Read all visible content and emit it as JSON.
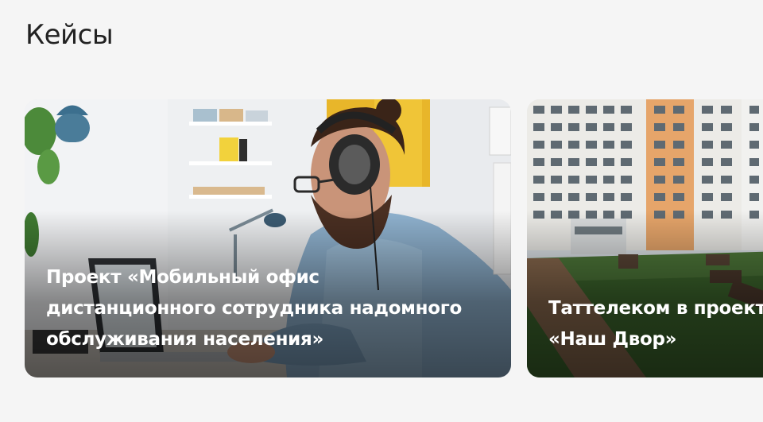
{
  "section": {
    "title": "Кейсы"
  },
  "cards": [
    {
      "caption": "Проект «Мобильный офис\nдистанционного сотрудника надомного\nобслуживания населения»",
      "image_subject": "man-with-headphones-at-laptop"
    },
    {
      "caption": "Таттелеком в проекте\n«Наш Двор»",
      "image_subject": "residential-courtyard"
    }
  ]
}
